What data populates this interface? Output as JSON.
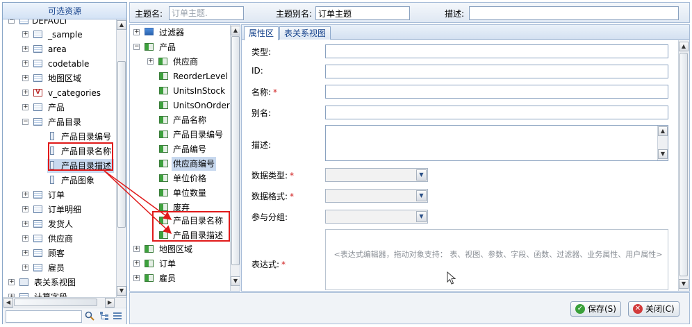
{
  "left_panel": {
    "title": "可选资源",
    "items": [
      {
        "label": "DEFAULT"
      },
      {
        "label": "_sample"
      },
      {
        "label": "area"
      },
      {
        "label": "codetable"
      },
      {
        "label": "地图区域"
      },
      {
        "label": "v_categories"
      },
      {
        "label": "产品"
      },
      {
        "label": "产品目录"
      },
      {
        "label": "产品目录编号"
      },
      {
        "label": "产品目录名称"
      },
      {
        "label": "产品目录描述"
      },
      {
        "label": "产品图象"
      },
      {
        "label": "订单"
      },
      {
        "label": "订单明细"
      },
      {
        "label": "发货人"
      },
      {
        "label": "供应商"
      },
      {
        "label": "顾客"
      },
      {
        "label": "雇员"
      },
      {
        "label": "表关系视图"
      },
      {
        "label": "计算字段"
      }
    ]
  },
  "topbar": {
    "subject_name_label": "主题名:",
    "subject_name_placeholder": "订单主题.",
    "subject_alias_label": "主题别名:",
    "subject_alias_value": "订单主题",
    "description_label": "描述:",
    "description_value": ""
  },
  "mid_tree": {
    "items": [
      {
        "label": "过滤器"
      },
      {
        "label": "产品"
      },
      {
        "label": "供应商"
      },
      {
        "label": "ReorderLevel"
      },
      {
        "label": "UnitsInStock"
      },
      {
        "label": "UnitsOnOrder"
      },
      {
        "label": "产品名称"
      },
      {
        "label": "产品目录编号"
      },
      {
        "label": "产品编号"
      },
      {
        "label": "供应商编号"
      },
      {
        "label": "单位价格"
      },
      {
        "label": "单位数量"
      },
      {
        "label": "废弃"
      },
      {
        "label": "产品目录名称"
      },
      {
        "label": "产品目录描述"
      },
      {
        "label": "地图区域"
      },
      {
        "label": "订单"
      },
      {
        "label": "雇员"
      }
    ]
  },
  "tabs": [
    {
      "label": "属性区"
    },
    {
      "label": "表关系视图"
    }
  ],
  "props": {
    "type_label": "类型:",
    "id_label": "ID:",
    "name_label": "名称:",
    "alias_label": "别名:",
    "desc_label": "描述:",
    "datatype_label": "数据类型:",
    "dataformat_label": "数据格式:",
    "grouping_label": "参与分组:",
    "expression_label": "表达式:",
    "required_mark": "*",
    "expression_hint": "<表达式编辑器，拖动对象支持：  表、视图、参数、字段、函数、过滤器、业务属性、用户属性>"
  },
  "buttons": {
    "save": "保存(S)",
    "close": "关闭(C)"
  },
  "colors": {
    "annotation_red": "#e01a1a",
    "accent_blue": "#15428b",
    "selection": "#c8d9ef"
  }
}
